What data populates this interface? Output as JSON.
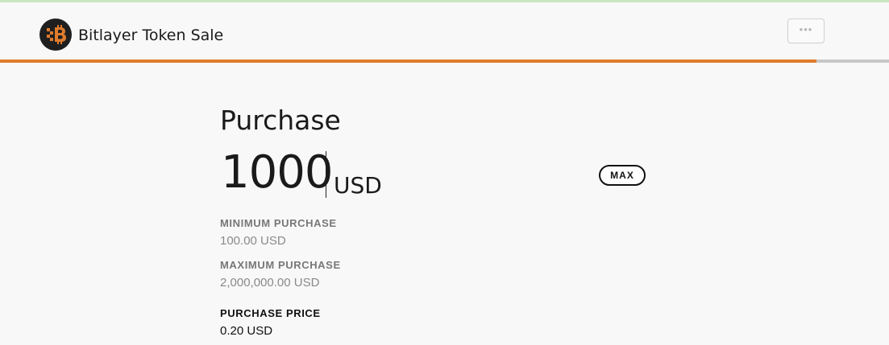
{
  "header": {
    "app_title": "Bitlayer Token Sale",
    "menu_label": "•••"
  },
  "progress": {
    "fraction": 0.918,
    "fill_color": "#e07b2c",
    "track_color": "#c8c8c8"
  },
  "purchase": {
    "heading": "Purchase",
    "amount": "1000",
    "currency": "USD",
    "max_label": "MAX"
  },
  "limits": {
    "minimum_label": "MINIMUM PURCHASE",
    "minimum_value": "100.00 USD",
    "maximum_label": "MAXIMUM PURCHASE",
    "maximum_value": "2,000,000.00 USD",
    "price_label": "PURCHASE PRICE",
    "price_value": "0.20 USD"
  },
  "icons": {
    "logo": "bitlayer-logo-icon",
    "menu": "more-dots-icon"
  }
}
